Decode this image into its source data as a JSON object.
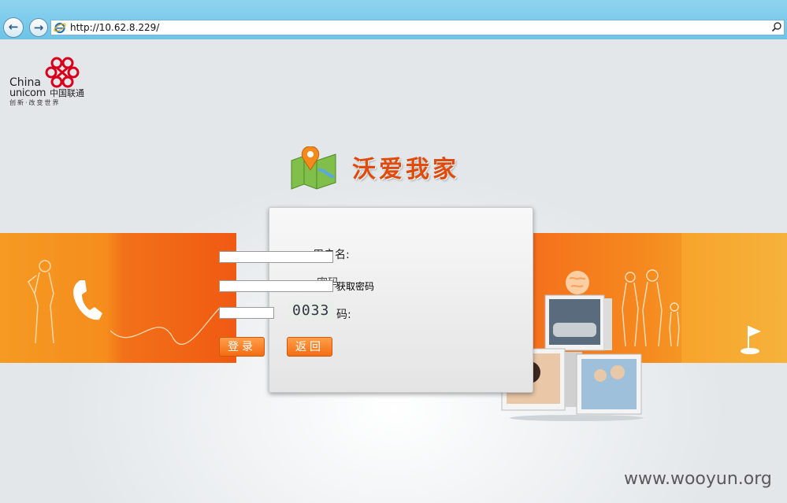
{
  "browser": {
    "url": "http://10.62.8.229/"
  },
  "logo": {
    "china": "China",
    "unicom": "unicom",
    "cn_name": "中国联通",
    "slogan": "创新·改变世界"
  },
  "app": {
    "title": "沃爱我家"
  },
  "login": {
    "username_label": "用户名:",
    "password_label": "密码",
    "get_password_link": "获取密码",
    "captcha_label": "码:",
    "captcha_value": "0033",
    "login_button": "登录",
    "back_button": "返回"
  },
  "watermark": "www.wooyun.org",
  "colors": {
    "accent_orange": "#f36c12",
    "title_orange": "#e04a0c",
    "unicom_red": "#d6001c"
  }
}
